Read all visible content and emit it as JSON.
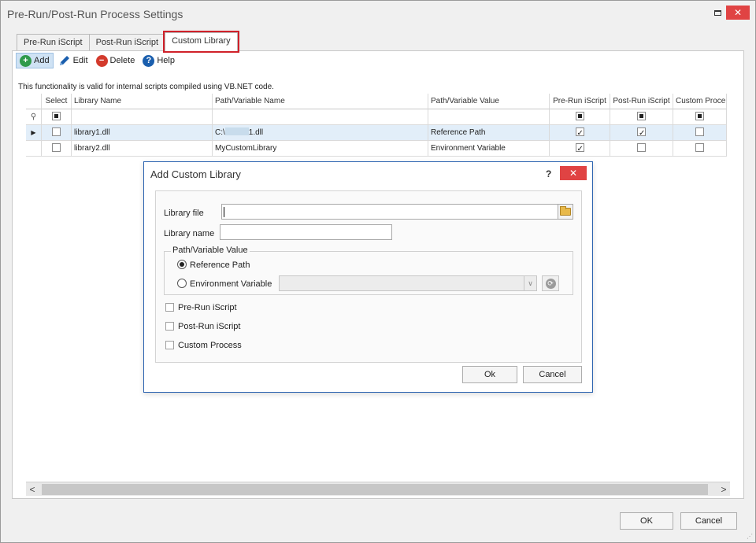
{
  "window": {
    "title": "Pre-Run/Post-Run Process Settings",
    "close_glyph": "✕"
  },
  "tabs": [
    {
      "label": "Pre-Run iScript",
      "active": false
    },
    {
      "label": "Post-Run iScript",
      "active": false
    },
    {
      "label": "Custom Library",
      "active": true
    }
  ],
  "toolbar": {
    "add_label": "Add",
    "edit_label": "Edit",
    "delete_label": "Delete",
    "help_label": "Help"
  },
  "info_text": "This functionality is valid for internal scripts compiled using VB.NET code.",
  "grid": {
    "columns": {
      "select": "Select",
      "library_name": "Library Name",
      "path_name": "Path/Variable Name",
      "path_value": "Path/Variable Value",
      "pre_run": "Pre-Run iScript",
      "post_run": "Post-Run iScript",
      "custom": "Custom Proce"
    },
    "rows": [
      {
        "library_name": "library1.dll",
        "path_prefix": "C:\\",
        "path_suffix": "1.dll",
        "path_value": "Reference Path",
        "pre_run": true,
        "post_run": true,
        "custom": false,
        "selected": true
      },
      {
        "library_name": "library2.dll",
        "path_name": "MyCustomLibrary",
        "path_value": "Environment Variable",
        "pre_run": true,
        "post_run": false,
        "custom": false,
        "selected": false
      }
    ]
  },
  "scrollbar": {
    "left_arrow": "<",
    "right_arrow": ">"
  },
  "footer": {
    "ok_label": "OK",
    "cancel_label": "Cancel"
  },
  "dialog": {
    "title": "Add Custom Library",
    "help_glyph": "?",
    "close_glyph": "✕",
    "library_file_label": "Library file",
    "library_file_value": "",
    "library_name_label": "Library name",
    "library_name_value": "",
    "group_title": "Path/Variable Value",
    "reference_path_label": "Reference Path",
    "environment_variable_label": "Environment Variable",
    "selected_option": "Reference Path",
    "pre_run_label": "Pre-Run iScript",
    "post_run_label": "Post-Run iScript",
    "custom_process_label": "Custom Process",
    "ok_label": "Ok",
    "cancel_label": "Cancel"
  },
  "colors": {
    "accent_highlight": "#d0212a",
    "close_red": "#e04343",
    "dialog_border": "#2b63b0",
    "selected_row": "#e2eef9"
  }
}
